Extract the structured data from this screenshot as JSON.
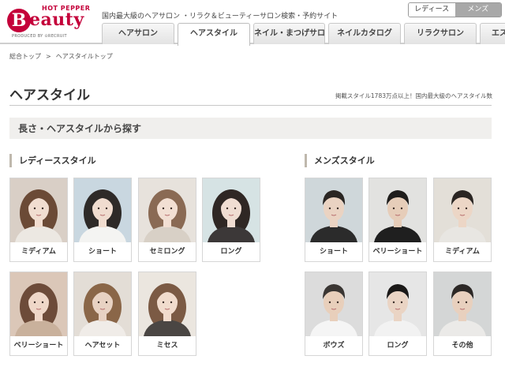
{
  "logo": {
    "hot_pepper": "HOT PEPPER",
    "b": "B",
    "beauty": "eauty",
    "produced_by": "PRODUCED BY ⊙RECRUIT"
  },
  "header": {
    "tagline": "国内最大級のヘアサロン ・リラク＆ビューティーサロン検索・予約サイト"
  },
  "gender_switch": {
    "ladies": "レディース",
    "mens": "メンズ",
    "selected": "ladies"
  },
  "tabs": [
    {
      "label": "ヘアサロン"
    },
    {
      "label": "ヘアスタイル",
      "active": true
    },
    {
      "label": "ネイル・まつげサロン"
    },
    {
      "label": "ネイルカタログ"
    },
    {
      "label": "リラクサロン"
    },
    {
      "label": "エス"
    }
  ],
  "breadcrumb": {
    "home": "総合トップ",
    "separator": ">",
    "current": "ヘアスタイルトップ"
  },
  "page": {
    "title": "ヘアスタイル",
    "note": "掲載スタイル1783万点以上！国内最大級のヘアスタイル数",
    "section_title": "長さ・ヘアスタイルから探す"
  },
  "ladies": {
    "heading": "レディーススタイル",
    "items": [
      {
        "label": "ミディアム",
        "bg": "#d9cfc6",
        "hair": "#6b4a36",
        "skin": "#f1ddd0",
        "cloth": "#ece8e2"
      },
      {
        "label": "ショート",
        "bg": "#c9d7e0",
        "hair": "#2e2a28",
        "skin": "#f0dccf",
        "cloth": "#f4f4f2"
      },
      {
        "label": "セミロング",
        "bg": "#e7e2dc",
        "hair": "#8a6a54",
        "skin": "#f2dfd3",
        "cloth": "#d8d0c6"
      },
      {
        "label": "ロング",
        "bg": "#d6e3e4",
        "hair": "#2f2724",
        "skin": "#f0ddd2",
        "cloth": "#3c3838"
      },
      {
        "label": "ベリーショート",
        "bg": "#dbc7b8",
        "hair": "#6d4b39",
        "skin": "#efd7c8",
        "cloth": "#c9b19c"
      },
      {
        "label": "ヘアセット",
        "bg": "#e3ddd6",
        "hair": "#8a6648",
        "skin": "#e8d2c3",
        "cloth": "#f0ece8"
      },
      {
        "label": "ミセス",
        "bg": "#ebe6df",
        "hair": "#7b5a44",
        "skin": "#f1dccd",
        "cloth": "#4a4643"
      }
    ]
  },
  "mens": {
    "heading": "メンズスタイル",
    "items": [
      {
        "label": "ショート",
        "bg": "#cfd7da",
        "hair": "#2a2623",
        "skin": "#ead3c2",
        "cloth": "#2b2b2b"
      },
      {
        "label": "ベリーショート",
        "bg": "#e2e2e0",
        "hair": "#1f1d1c",
        "skin": "#e6cdb9",
        "cloth": "#1f1f1f"
      },
      {
        "label": "ミディアム",
        "bg": "#e3dfd8",
        "hair": "#2a2522",
        "skin": "#ecd6c6",
        "cloth": "#e8e6e2"
      },
      {
        "label": "ボウズ",
        "bg": "#dcdcdc",
        "hair": "#3a3633",
        "skin": "#e8cfbb",
        "cloth": "#f5f5f5"
      },
      {
        "label": "ロング",
        "bg": "#e6e6e6",
        "hair": "#1b1918",
        "skin": "#ead4c4",
        "cloth": "#f2f2f2"
      },
      {
        "label": "その他",
        "bg": "#d4d6d6",
        "hair": "#2c2826",
        "skin": "#e8d0be",
        "cloth": "#ebeae8"
      }
    ]
  }
}
